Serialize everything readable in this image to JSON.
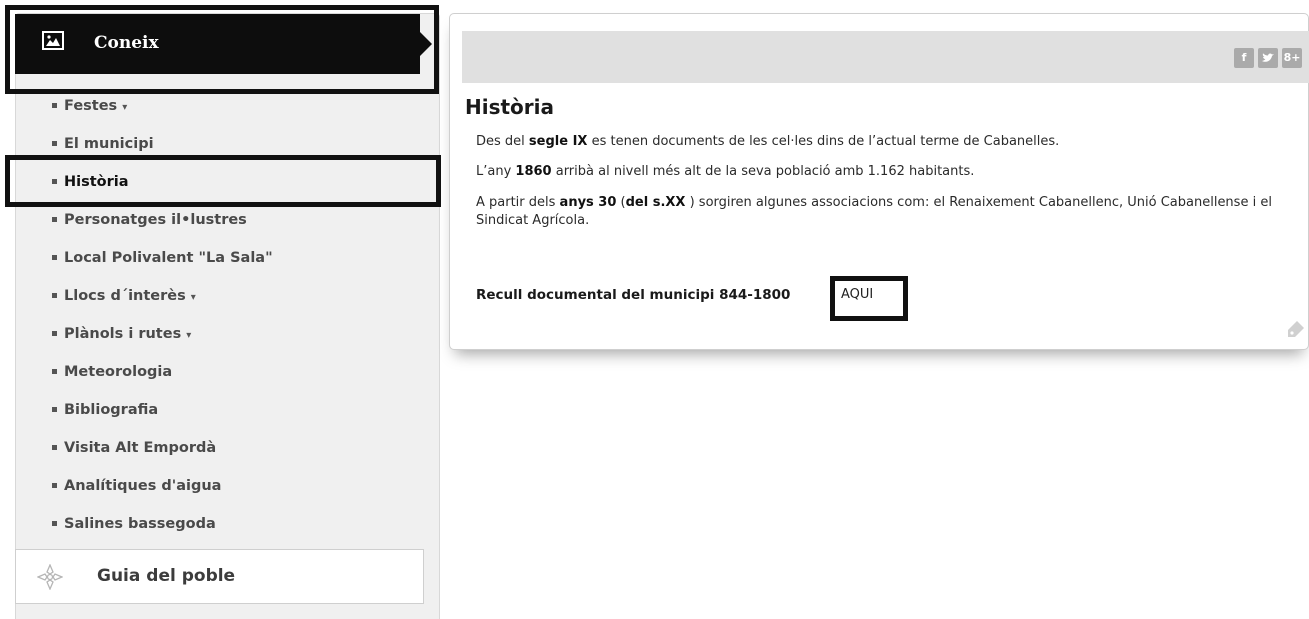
{
  "sidebar": {
    "header_title": "Coneix",
    "items": [
      {
        "label": "Festes",
        "caret": "▾"
      },
      {
        "label": "El municipi",
        "caret": ""
      },
      {
        "label": "Història",
        "caret": ""
      },
      {
        "label": "Personatges il•lustres",
        "caret": ""
      },
      {
        "label": "Local Polivalent \"La Sala\"",
        "caret": ""
      },
      {
        "label": "Llocs d´interès",
        "caret": "▾"
      },
      {
        "label": "Plànols i rutes",
        "caret": "▾"
      },
      {
        "label": "Meteorologia",
        "caret": ""
      },
      {
        "label": "Bibliografia",
        "caret": ""
      },
      {
        "label": "Visita Alt Empordà",
        "caret": ""
      },
      {
        "label": "Analítiques d'aigua",
        "caret": ""
      },
      {
        "label": "Salines bassegoda",
        "caret": ""
      }
    ],
    "guide_label": "Guia del poble"
  },
  "social": {
    "facebook": "f",
    "twitter": "t",
    "googleplus": "8+"
  },
  "content": {
    "title": "Història",
    "p1": {
      "pre": "Des del ",
      "bold": "segle IX",
      "post": " es tenen documents de les cel·les dins de l’actual terme de Cabanelles."
    },
    "p2": {
      "pre": "L’any ",
      "bold": "1860",
      "post": " arribà al nivell més alt de la seva població amb 1.162 habitants."
    },
    "p3": {
      "pre": "A partir dels ",
      "bold1": "anys 30",
      "mid1": " (",
      "bold2": "del s.XX",
      "post": " ) sorgiren algunes associacions com: el Renaixement Cabanellenc, Unió Cabanellense i el Sindicat Agrícola."
    },
    "recull_label": "Recull documental del municipi 844-1800",
    "aqui_link": "AQUI"
  },
  "icons": {
    "header": "image-icon",
    "guide": "compass-rose-icon",
    "tag": "tag-icon"
  }
}
